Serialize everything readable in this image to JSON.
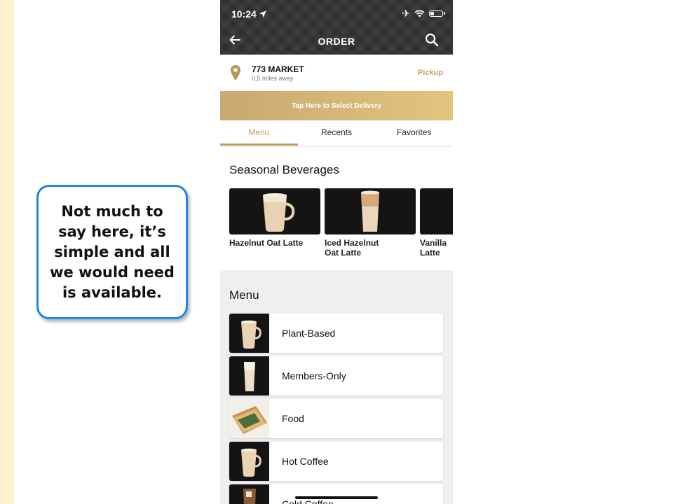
{
  "callout": {
    "text": "Not much to\nsay here, it’s\nsimple and all\nwe would need\nis available."
  },
  "status_bar": {
    "time": "10:24",
    "battery_level": 0.25
  },
  "header": {
    "title": "ORDER",
    "back_icon": "back-arrow-icon",
    "search_icon": "search-icon"
  },
  "store": {
    "name": "773 MARKET",
    "distance": "0,5 miles away",
    "mode": "Pickup",
    "icon": "map-pin-icon"
  },
  "delivery": {
    "label": "Tap Here to Select Delivery"
  },
  "tabs": [
    {
      "label": "Menu",
      "active": true
    },
    {
      "label": "Recents",
      "active": false
    },
    {
      "label": "Favorites",
      "active": false
    }
  ],
  "seasonal": {
    "title": "Seasonal Beverages",
    "items": [
      {
        "label": "Hazelnut Oat Latte"
      },
      {
        "label": "Iced Hazelnut\nOat Latte"
      },
      {
        "label": "Vanilla \nLatte"
      }
    ]
  },
  "menu": {
    "title": "Menu",
    "items": [
      {
        "label": "Plant-Based"
      },
      {
        "label": "Members-Only"
      },
      {
        "label": "Food"
      },
      {
        "label": "Hot Coffee"
      },
      {
        "label": "Cold Coffee"
      }
    ]
  },
  "colors": {
    "accent": "#c29a5b",
    "header_bg": "#2f2f2f",
    "callout_border": "#1e88e5",
    "slide_strip": "#fff2cc"
  }
}
